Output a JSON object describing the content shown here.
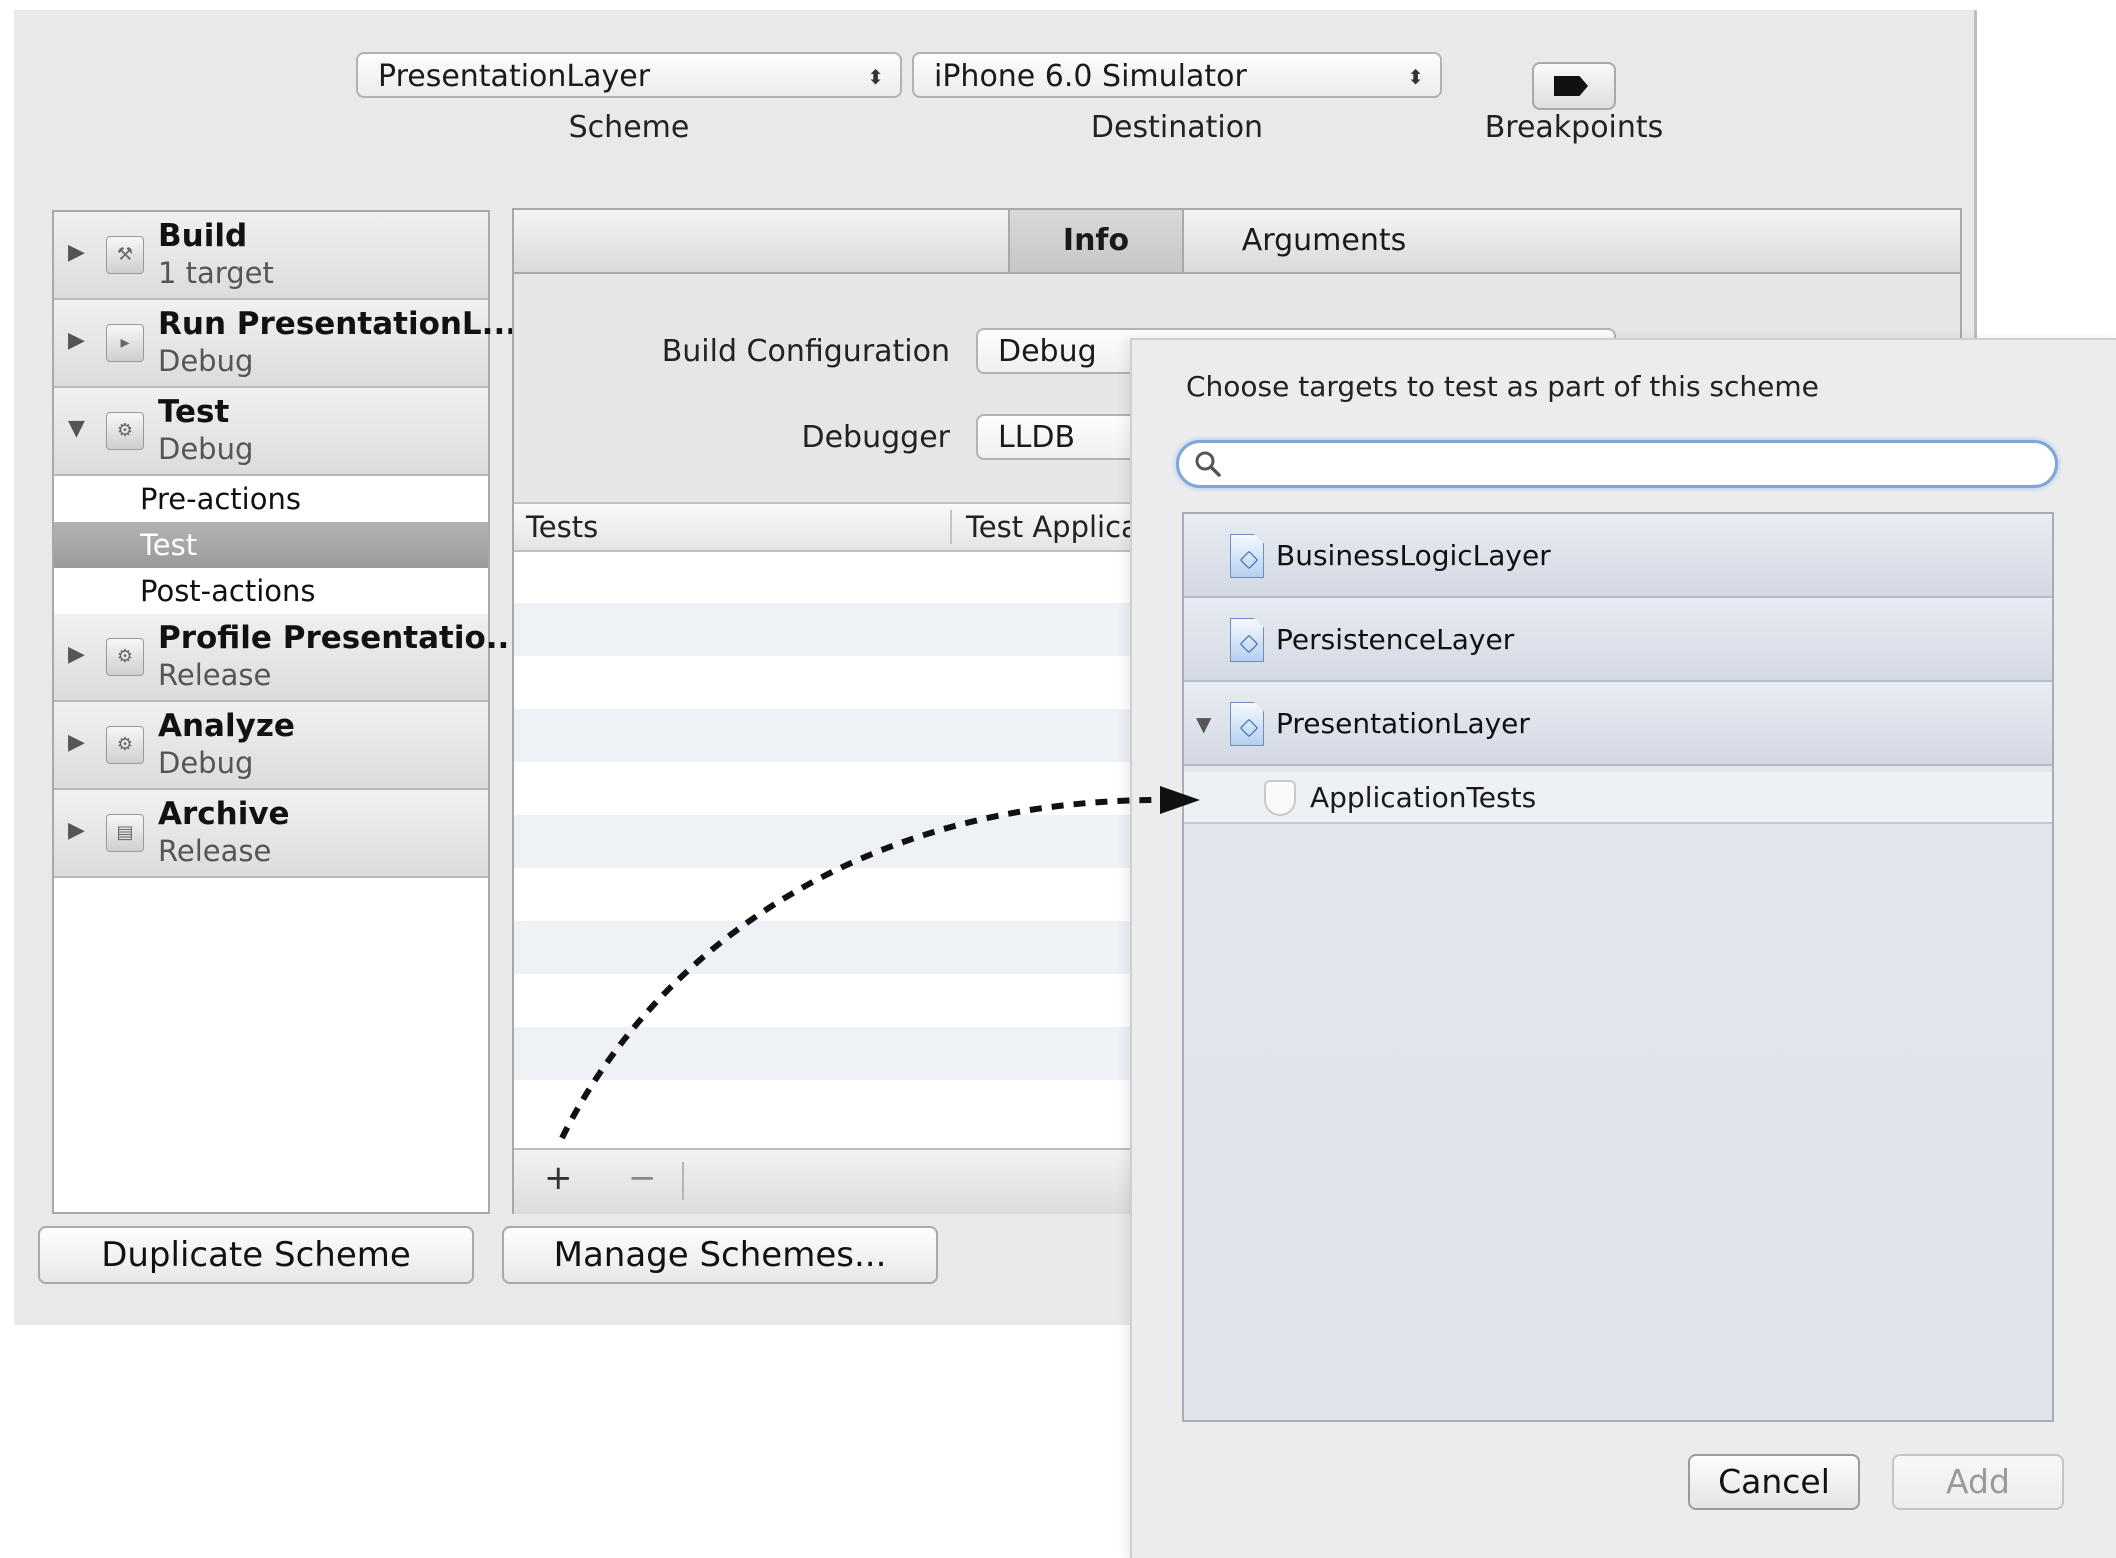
{
  "toolbar": {
    "scheme_value": "PresentationLayer",
    "scheme_label": "Scheme",
    "destination_value": "iPhone 6.0 Simulator",
    "destination_label": "Destination",
    "breakpoints_label": "Breakpoints"
  },
  "actions": [
    {
      "title": "Build",
      "subtitle": "1 target",
      "expanded": false
    },
    {
      "title": "Run PresentationL...",
      "subtitle": "Debug",
      "expanded": false
    },
    {
      "title": "Test",
      "subtitle": "Debug",
      "expanded": true
    },
    {
      "title": "Profile Presentatio...",
      "subtitle": "Release",
      "expanded": false
    },
    {
      "title": "Analyze",
      "subtitle": "Debug",
      "expanded": false
    },
    {
      "title": "Archive",
      "subtitle": "Release",
      "expanded": false
    }
  ],
  "test_subitems": [
    {
      "label": "Pre-actions",
      "selected": false
    },
    {
      "label": "Test",
      "selected": true
    },
    {
      "label": "Post-actions",
      "selected": false
    }
  ],
  "tabs": {
    "info": "Info",
    "arguments": "Arguments"
  },
  "form": {
    "build_config_label": "Build Configuration",
    "build_config_value": "Debug",
    "debugger_label": "Debugger",
    "debugger_value": "LLDB"
  },
  "tests_table": {
    "col_tests": "Tests",
    "col_test_application": "Test Applica",
    "add_symbol": "+",
    "remove_symbol": "−"
  },
  "buttons": {
    "duplicate_scheme": "Duplicate Scheme",
    "manage_schemes": "Manage Schemes..."
  },
  "targets_sheet": {
    "prompt": "Choose targets to test as part of this scheme",
    "search_placeholder": "",
    "targets": [
      {
        "label": "BusinessLogicLayer",
        "expanded": false
      },
      {
        "label": "PersistenceLayer",
        "expanded": false
      },
      {
        "label": "PresentationLayer",
        "expanded": true
      }
    ],
    "test_bundle": "ApplicationTests",
    "cancel": "Cancel",
    "add": "Add"
  },
  "colors": {
    "accent_focus": "#7ea7d8",
    "selected_row": "#9a9a9a",
    "arrow": "#111111"
  },
  "icons": {
    "disclosure_collapsed": "disclosure-right-icon",
    "disclosure_expanded": "disclosure-down-icon",
    "search": "search-icon",
    "target": "app-target-icon",
    "test_bundle": "test-bundle-icon",
    "breakpoint": "breakpoint-icon"
  }
}
